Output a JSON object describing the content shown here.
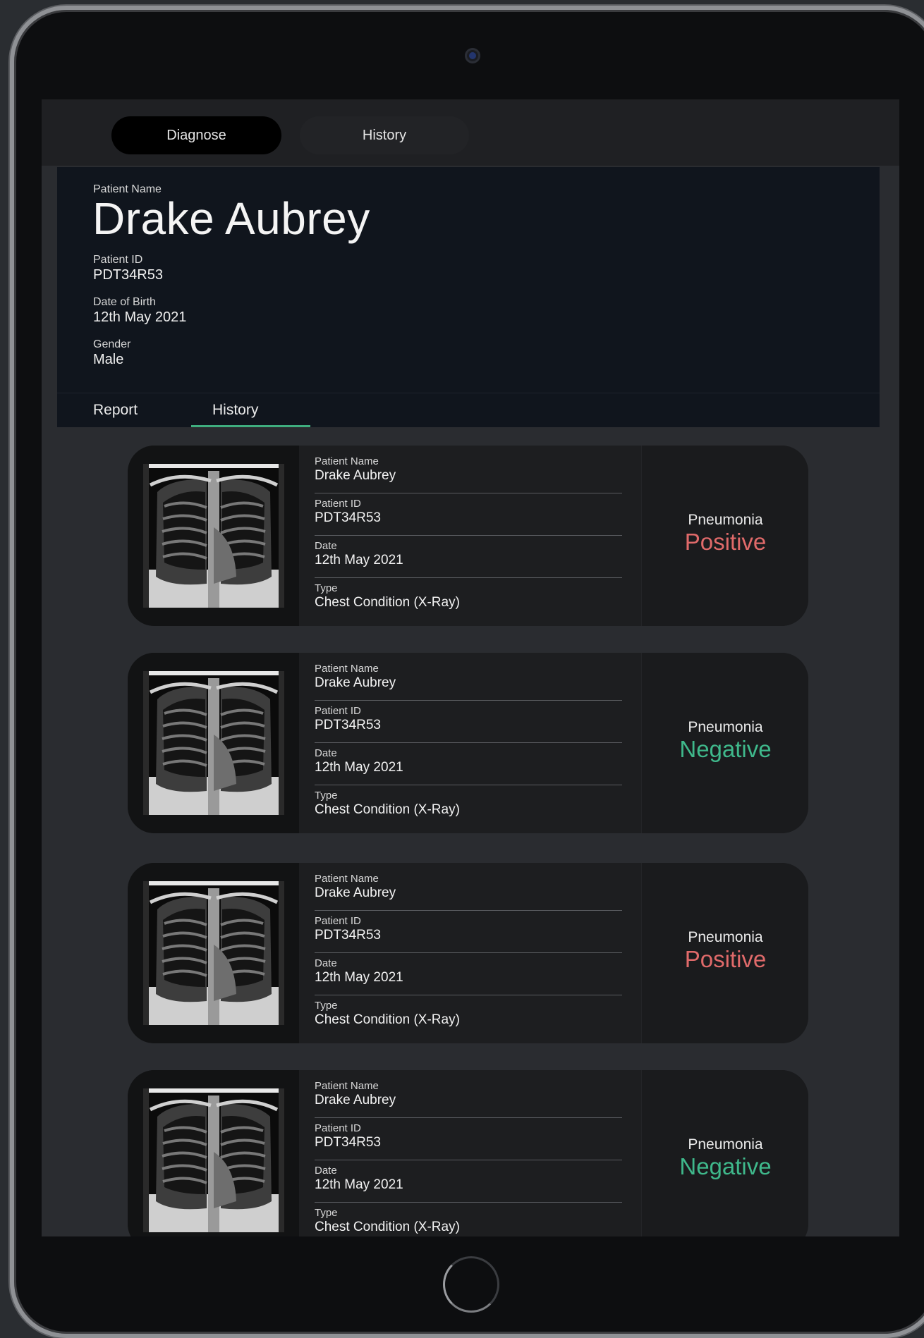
{
  "nav": {
    "diagnose_label": "Diagnose",
    "history_label": "History"
  },
  "patient": {
    "name_label": "Patient Name",
    "name": "Drake Aubrey",
    "id_label": "Patient ID",
    "id": "PDT34R53",
    "dob_label": "Date of Birth",
    "dob": "12th May 2021",
    "gender_label": "Gender",
    "gender": "Male"
  },
  "tabs": {
    "report_label": "Report",
    "history_label": "History"
  },
  "colors": {
    "positive": "#e06a6a",
    "negative": "#3fb88b",
    "accent": "#3fae7f"
  },
  "records": [
    {
      "name_label": "Patient Name",
      "name": "Drake Aubrey",
      "id_label": "Patient ID",
      "id": "PDT34R53",
      "date_label": "Date",
      "date": "12th May 2021",
      "type_label": "Type",
      "type": "Chest Condition (X-Ray)",
      "condition": "Pneumonia",
      "result": "Positive"
    },
    {
      "name_label": "Patient Name",
      "name": "Drake Aubrey",
      "id_label": "Patient ID",
      "id": "PDT34R53",
      "date_label": "Date",
      "date": "12th May 2021",
      "type_label": "Type",
      "type": "Chest Condition (X-Ray)",
      "condition": "Pneumonia",
      "result": "Negative"
    },
    {
      "name_label": "Patient Name",
      "name": "Drake Aubrey",
      "id_label": "Patient ID",
      "id": "PDT34R53",
      "date_label": "Date",
      "date": "12th May 2021",
      "type_label": "Type",
      "type": "Chest Condition (X-Ray)",
      "condition": "Pneumonia",
      "result": "Positive"
    },
    {
      "name_label": "Patient Name",
      "name": "Drake Aubrey",
      "id_label": "Patient ID",
      "id": "PDT34R53",
      "date_label": "Date",
      "date": "12th May 2021",
      "type_label": "Type",
      "type": "Chest Condition (X-Ray)",
      "condition": "Pneumonia",
      "result": "Negative"
    }
  ]
}
